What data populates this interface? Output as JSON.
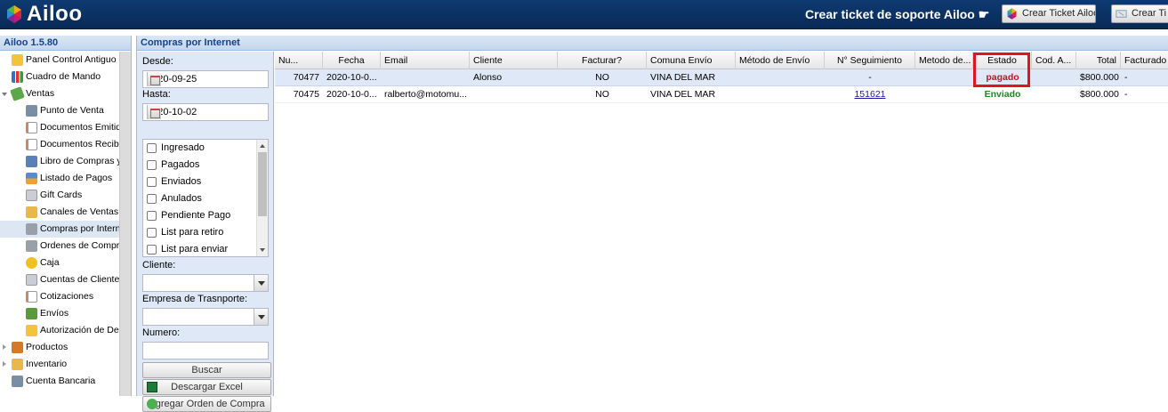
{
  "app": {
    "logo_text": "Ailoo"
  },
  "header": {
    "support_text": "Crear ticket de soporte Ailoo",
    "support_arrow": "☛",
    "btn_create_ticket": "Crear Ticket Ailoo",
    "btn_create_ticket_2": "Crear Ti"
  },
  "sidebar": {
    "title": "Ailoo 1.5.80",
    "items": [
      {
        "label": "Panel Control Antiguo"
      },
      {
        "label": "Cuadro de Mando"
      },
      {
        "label": "Ventas"
      },
      {
        "label": "Punto de Venta"
      },
      {
        "label": "Documentos Emitidos"
      },
      {
        "label": "Documentos Recibidos"
      },
      {
        "label": "Libro de Compras y Ventas"
      },
      {
        "label": "Listado de Pagos"
      },
      {
        "label": "Gift Cards"
      },
      {
        "label": "Canales de Ventas"
      },
      {
        "label": "Compras por Internet"
      },
      {
        "label": "Ordenes de Compra"
      },
      {
        "label": "Caja"
      },
      {
        "label": "Cuentas de Clientes"
      },
      {
        "label": "Cotizaciones"
      },
      {
        "label": "Envíos"
      },
      {
        "label": "Autorización de Descuentos"
      },
      {
        "label": "Productos"
      },
      {
        "label": "Inventario"
      },
      {
        "label": "Cuenta Bancaria"
      }
    ]
  },
  "main": {
    "title": "Compras por Internet",
    "filters": {
      "desde_label": "Desde:",
      "desde_value": "2020-09-25",
      "hasta_label": "Hasta:",
      "hasta_value": "2020-10-02",
      "status_options": [
        "Ingresado",
        "Pagados",
        "Enviados",
        "Anulados",
        "Pendiente Pago",
        "List para retiro",
        "List para enviar"
      ],
      "cliente_label": "Cliente:",
      "empresa_label": "Empresa de Trasnporte:",
      "numero_label": "Numero:",
      "buscar": "Buscar",
      "descargar": "Descargar Excel",
      "agregar": "Agregar Orden de Compra"
    },
    "grid": {
      "columns": [
        "Nu...",
        "Fecha",
        "Email",
        "Cliente",
        "Facturar?",
        "Comuna Envío",
        "Método de Envío",
        "N° Seguimiento",
        "Metodo de...",
        "Estado",
        "Cod. A...",
        "Total",
        "Facturado"
      ],
      "rows": [
        {
          "numero": "70477",
          "fecha": "2020-10-0...",
          "email": "",
          "cliente": "Alonso",
          "facturar": "NO",
          "comuna": "VINA DEL MAR",
          "metodo_envio": "",
          "seguimiento": "-",
          "metodo_pago": "",
          "estado": "pagado",
          "cod": "",
          "total": "$800.000",
          "facturado": "-"
        },
        {
          "numero": "70475",
          "fecha": "2020-10-0...",
          "email": "ralberto@motomu...",
          "cliente": "",
          "facturar": "NO",
          "comuna": "VINA DEL MAR",
          "metodo_envio": "",
          "seguimiento": "151621",
          "metodo_pago": "",
          "estado": "Enviado",
          "cod": "",
          "total": "$800.000",
          "facturado": "-"
        }
      ]
    }
  },
  "colors": {
    "header_bg": "#0b3366",
    "panel_header": "#c4d7ee",
    "estado_pagado": "#d4121c",
    "estado_enviado": "#1b8a1b",
    "highlight": "#e0141e"
  }
}
